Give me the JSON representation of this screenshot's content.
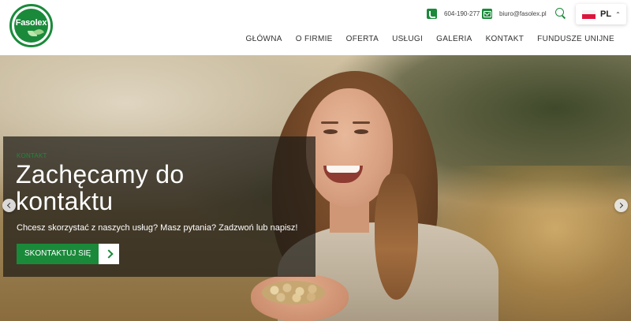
{
  "brand": {
    "logo_text": "Fasolex",
    "accent_color": "#1a8a3a"
  },
  "top_bar": {
    "phone": "604-190-277",
    "email": "biuro@fasolex.pl",
    "language": "PL"
  },
  "nav": {
    "items": [
      "GŁÓWNA",
      "O FIRMIE",
      "OFERTA",
      "USŁUGI",
      "GALERIA",
      "KONTAKT",
      "FUNDUSZE UNIJNE"
    ]
  },
  "hero": {
    "kicker": "KONTAKT",
    "title": "Zachęcamy do kontaktu",
    "subtitle": "Chcesz skorzystać z naszych usług? Masz pytania? Zadzwoń lub napisz!",
    "cta_label": "SKONTAKTUJ SIĘ"
  },
  "icons": [
    "phone-icon",
    "mail-icon",
    "search-icon",
    "flag-pl-icon",
    "chevron-up-icon",
    "chevron-right-icon",
    "arrow-left-icon",
    "arrow-right-icon"
  ]
}
